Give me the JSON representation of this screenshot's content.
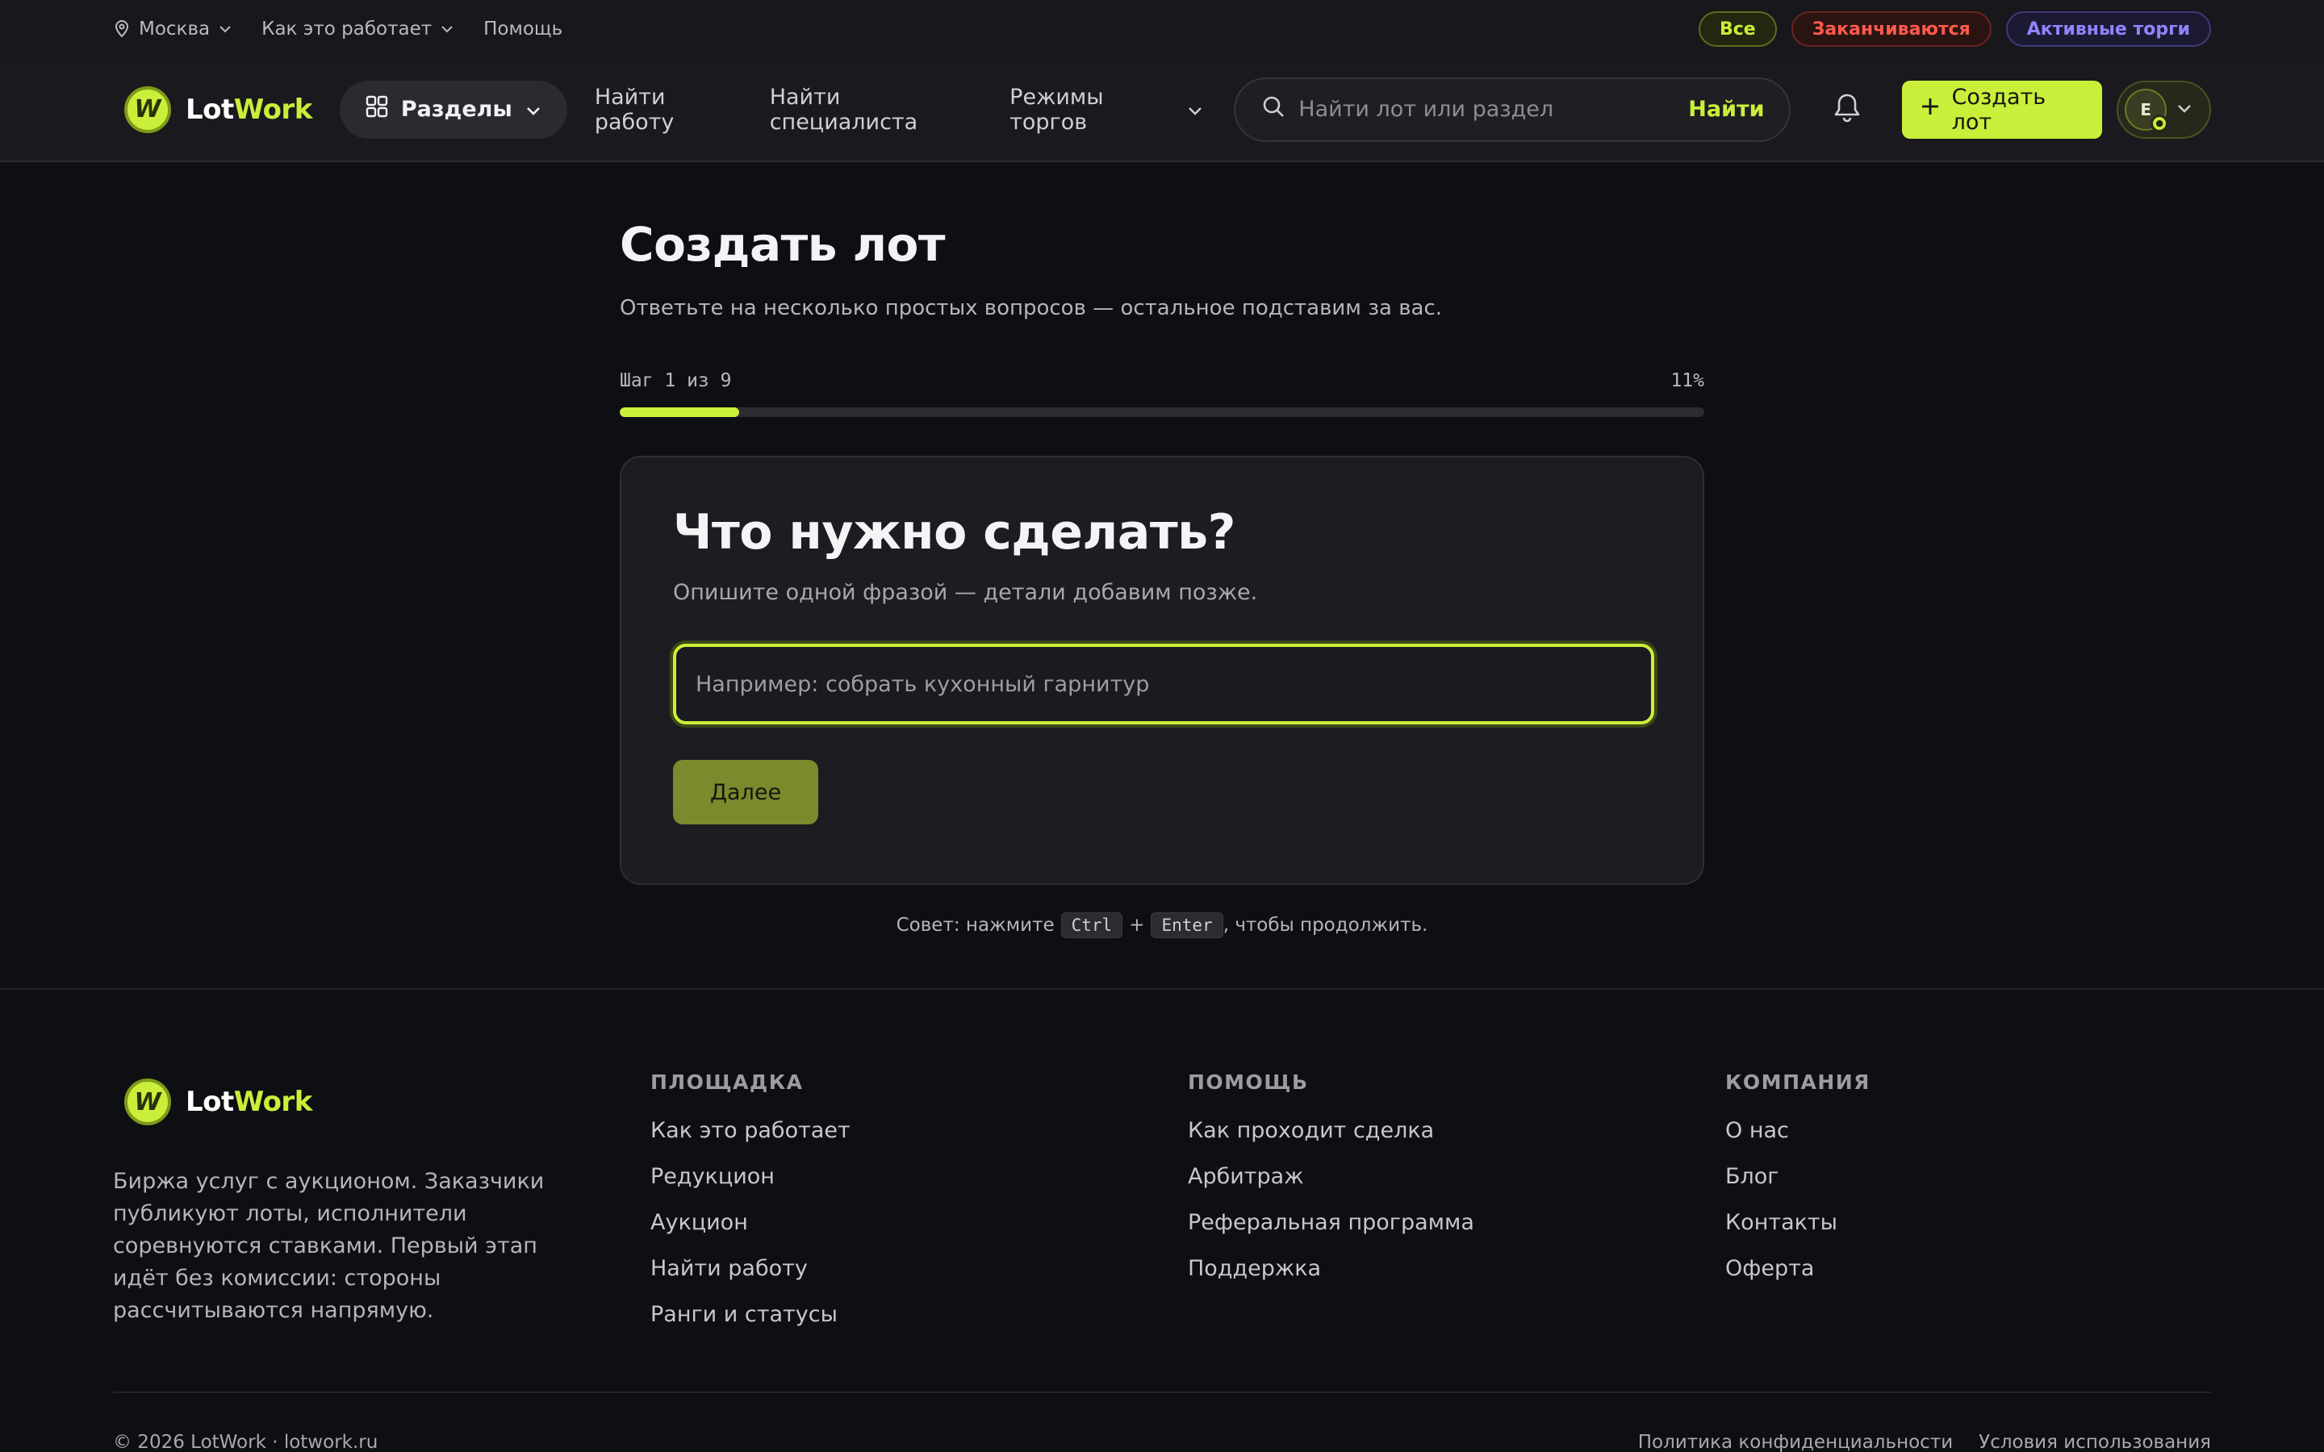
{
  "topbar": {
    "city": "Москва",
    "how_it_works": "Как это работает",
    "help": "Помощь",
    "filters": [
      "Все",
      "Заканчиваются",
      "Активные торги"
    ]
  },
  "header": {
    "logo_part1": "Lot",
    "logo_part2": "Work",
    "sections_label": "Разделы",
    "nav": [
      "Найти работу",
      "Найти специалиста",
      "Режимы торгов"
    ],
    "search_placeholder": "Найти лот или раздел",
    "search_button": "Найти",
    "create_button": "Создать лот",
    "avatar_initial": "E"
  },
  "main": {
    "title": "Создать лот",
    "subtitle": "Ответьте на несколько простых вопросов — остальное подставим за вас.",
    "step_label": "Шаг 1 из 9",
    "progress_label": "11%",
    "progress_value": 0.11,
    "card": {
      "title": "Что нужно сделать?",
      "subtitle": "Опишите одной фразой — детали добавим позже.",
      "input_placeholder": "Например: собрать кухонный гарнитур",
      "input_value": "",
      "next_button": "Далее"
    },
    "hint": {
      "prefix": "Совет: нажмите",
      "key1": "Ctrl",
      "plus": "+",
      "key2": "Enter",
      "suffix": ", чтобы продолжить."
    }
  },
  "footer": {
    "description": "Биржа услуг с аукционом. Заказчики публикуют лоты, исполнители соревнуются ставками. Первый этап идёт без комиссии: стороны рассчитываются напрямую.",
    "columns": [
      {
        "title": "ПЛОЩАДКА",
        "links": [
          "Как это работает",
          "Редукцион",
          "Аукцион",
          "Найти работу",
          "Ранги и статусы"
        ]
      },
      {
        "title": "ПОМОЩЬ",
        "links": [
          "Как проходит сделка",
          "Арбитраж",
          "Реферальная программа",
          "Поддержка"
        ]
      },
      {
        "title": "КОМПАНИЯ",
        "links": [
          "О нас",
          "Блог",
          "Контакты",
          "Оферта"
        ]
      }
    ],
    "copyright": "© 2026 LotWork · lotwork.ru",
    "legal": [
      "Политика конфиденциальности",
      "Условия использования"
    ]
  },
  "colors": {
    "accent": "#c9ef3a",
    "background": "#0e0f12",
    "danger": "#ff5a4d",
    "violet": "#8f86ff"
  },
  "icons": [
    "location-pin-icon",
    "chevron-down-icon",
    "grid-icon",
    "search-icon",
    "bell-icon",
    "plus-icon"
  ]
}
